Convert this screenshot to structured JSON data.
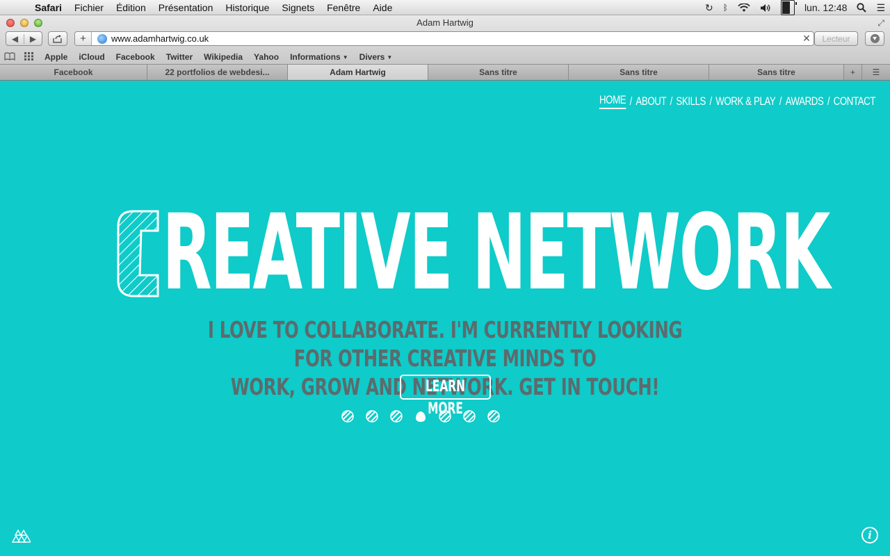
{
  "menubar": {
    "app_name": "Safari",
    "items": [
      "Fichier",
      "Édition",
      "Présentation",
      "Historique",
      "Signets",
      "Fenêtre",
      "Aide"
    ],
    "clock": "lun. 12:48"
  },
  "window": {
    "title": "Adam Hartwig"
  },
  "toolbar": {
    "url": "www.adamhartwig.co.uk",
    "reader_label": "Lecteur"
  },
  "bookmarks": [
    "Apple",
    "iCloud",
    "Facebook",
    "Twitter",
    "Wikipedia",
    "Yahoo",
    "Informations",
    "Divers"
  ],
  "tabs": [
    {
      "label": "Facebook",
      "active": false
    },
    {
      "label": "22 portfolios de webdesi...",
      "active": false
    },
    {
      "label": "Adam Hartwig",
      "active": true
    },
    {
      "label": "Sans titre",
      "active": false
    },
    {
      "label": "Sans titre",
      "active": false
    },
    {
      "label": "Sans titre",
      "active": false
    }
  ],
  "site": {
    "nav": [
      "HOME",
      "ABOUT",
      "SKILLS",
      "WORK & PLAY",
      "AWARDS",
      "CONTACT"
    ],
    "nav_separator": "/",
    "active_nav": "HOME",
    "hero_title_rest": "REATIVE NETWORK",
    "hero_title_initial": "C",
    "tagline_line1": "I love to collaborate. I'm currently looking for other creative minds to",
    "tagline_line2": "work, grow and network. Get in touch!",
    "cta_label": "LEARN MORE",
    "slider": {
      "count": 7,
      "active_index": 3
    },
    "colors": {
      "background": "#0fcbc9",
      "accent_text": "#5c6b6d",
      "foreground": "#ffffff"
    }
  }
}
